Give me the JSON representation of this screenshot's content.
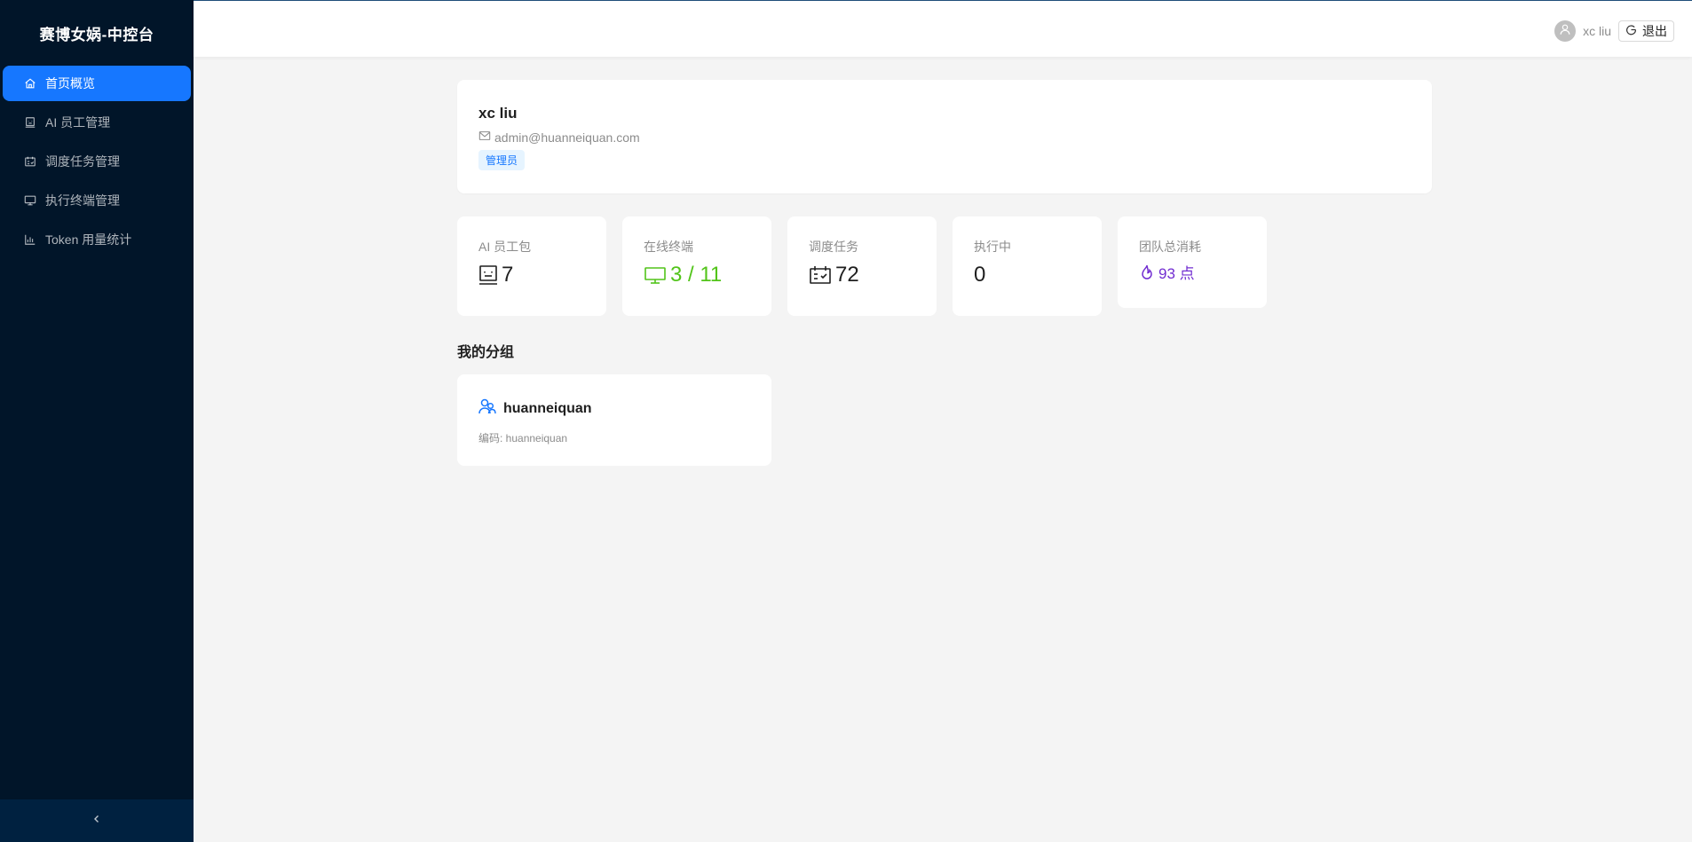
{
  "app": {
    "title": "赛博女娲-中控台"
  },
  "sidebar": {
    "items": [
      {
        "label": "首页概览",
        "icon": "home-icon",
        "active": true
      },
      {
        "label": "AI 员工管理",
        "icon": "robot-icon",
        "active": false
      },
      {
        "label": "调度任务管理",
        "icon": "schedule-icon",
        "active": false
      },
      {
        "label": "执行终端管理",
        "icon": "desktop-icon",
        "active": false
      },
      {
        "label": "Token 用量统计",
        "icon": "bar-chart-icon",
        "active": false
      }
    ],
    "collapse_icon": "chevron-left-icon"
  },
  "header": {
    "user_name": "xc liu",
    "logout_label": "退出"
  },
  "profile": {
    "name": "xc liu",
    "email": "admin@huanneiquan.com",
    "role": "管理员"
  },
  "stats": [
    {
      "title": "AI 员工包",
      "value": "7",
      "icon": "robot-icon"
    },
    {
      "title": "在线终端",
      "value": "3 / 11",
      "icon": "desktop-icon",
      "color": "#52c41a"
    },
    {
      "title": "调度任务",
      "value": "72",
      "icon": "schedule-icon"
    },
    {
      "title": "执行中",
      "value": "0"
    },
    {
      "title": "团队总消耗",
      "value": "93 点",
      "icon": "fire-icon",
      "color": "#722ed1"
    }
  ],
  "groups": {
    "title": "我的分组",
    "items": [
      {
        "name": "huanneiquan",
        "code": "编码: huanneiquan",
        "icon": "team-icon"
      }
    ]
  },
  "colors": {
    "sidebar_bg": "#011529",
    "primary": "#1677ff",
    "success": "#52c41a",
    "purple": "#722ed1"
  }
}
